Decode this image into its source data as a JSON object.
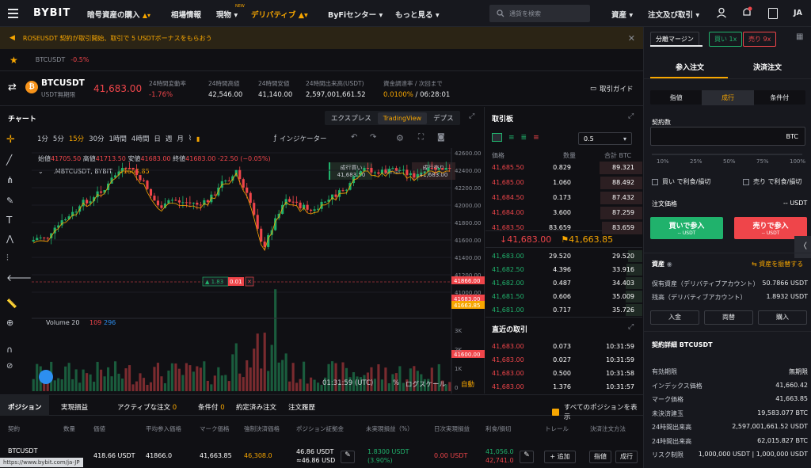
{
  "nav": {
    "logo": "BYBIT",
    "items": [
      "暗号資産の購入",
      "相場情報",
      "現物",
      "デリバティブ",
      "ByFiセンター",
      "もっと見る"
    ],
    "new_badge": "NEW",
    "search_placeholder": "通貨を検索",
    "right": [
      "資産",
      "注文及び取引"
    ],
    "lang": "JA"
  },
  "banner": {
    "text": "ROSEUSDT 契約が取引開始、取引で 5 USDTボーナスをもらおう"
  },
  "ticker_tab": {
    "symbol": "BTCUSDT",
    "change": "-0.5%"
  },
  "header": {
    "symbol": "BTCUSDT",
    "subtitle": "USDT無期限",
    "price": "41,683.00",
    "stats": [
      {
        "label": "24時間変動率",
        "value": "-1.76%",
        "color": "red"
      },
      {
        "label": "24時間高値",
        "value": "42,546.00"
      },
      {
        "label": "24時間安値",
        "value": "41,140.00"
      },
      {
        "label": "24時間出来高(USDT)",
        "value": "2,597,001,661.52"
      },
      {
        "label": "資金調達率 / 次回まで",
        "value": "0.0100% / 06:28:01"
      }
    ],
    "guide": "取引ガイド"
  },
  "chart": {
    "title": "チャート",
    "views": [
      "エクスプレス",
      "TradingView",
      "デプス"
    ],
    "active_view": "TradingView",
    "intervals": [
      "1分",
      "5分",
      "15分",
      "30分",
      "1時間",
      "4時間",
      "日",
      "週",
      "月"
    ],
    "active_interval": "15分",
    "indicator_label": "インジケーター",
    "ohlc": {
      "o_label": "始値",
      "o": "41705.50",
      "h_label": "高値",
      "h": "41713.50",
      "l_label": "安値",
      "l": "41683.00",
      "c_label": "終値",
      "c": "41683.00",
      "chg": "-22.50 (−0.05%)"
    },
    "series_label": ".MBTCUSDT, BYBIT",
    "series_value": "41663.85",
    "buy_box": {
      "label": "成行買い",
      "value": "41,683.50"
    },
    "qty_label": "契約数",
    "sell_box": {
      "label": "成行売り",
      "value": "41,683.00"
    },
    "pos_tag": {
      "qty": "1.83",
      "pnl": "0.01"
    },
    "volume_label": "Volume 20",
    "volume_values": [
      "109",
      "296"
    ],
    "price_ticks": [
      "42600.00",
      "42400.00",
      "42200.00",
      "42000.00",
      "41800.00",
      "41600.00",
      "41400.00",
      "41200.00",
      "41000.00"
    ],
    "price_tags": [
      "41866.00",
      "41683.00",
      "41663.85",
      "41600.00"
    ],
    "vol_ticks": [
      "3K",
      "2K",
      "1K",
      "0"
    ],
    "time_ticks": [
      "06:00",
      "09:00",
      "12:00",
      "15:00",
      "18:00",
      "21:00",
      "20",
      "03:00"
    ],
    "clock": "01:31:59 (UTC)",
    "pct": "%",
    "log": "ログスケール",
    "auto": "自動"
  },
  "orderbook": {
    "title": "取引板",
    "step": "0.5",
    "headers": [
      "価格",
      "数量",
      "合計 BTC"
    ],
    "asks": [
      {
        "price": "41,685.50",
        "qty": "0.829",
        "total": "89.321",
        "depth": 0.98
      },
      {
        "price": "41,685.00",
        "qty": "1.060",
        "total": "88.492",
        "depth": 0.97
      },
      {
        "price": "41,684.50",
        "qty": "0.173",
        "total": "87.432",
        "depth": 0.96
      },
      {
        "price": "41,684.00",
        "qty": "3.600",
        "total": "87.259",
        "depth": 0.96
      },
      {
        "price": "41,683.50",
        "qty": "83.659",
        "total": "83.659",
        "depth": 0.92
      }
    ],
    "last_price": "41,683.00",
    "mark_price": "41,663.85",
    "bids": [
      {
        "price": "41,683.00",
        "qty": "29.520",
        "total": "29.520",
        "depth": 0.32
      },
      {
        "price": "41,682.50",
        "qty": "4.396",
        "total": "33.916",
        "depth": 0.37
      },
      {
        "price": "41,682.00",
        "qty": "0.487",
        "total": "34.403",
        "depth": 0.38
      },
      {
        "price": "41,681.50",
        "qty": "0.606",
        "total": "35.009",
        "depth": 0.38
      },
      {
        "price": "41,681.00",
        "qty": "0.717",
        "total": "35.726",
        "depth": 0.39
      }
    ]
  },
  "trades": {
    "title": "直近の取引",
    "rows": [
      {
        "price": "41,683.00",
        "qty": "0.073",
        "time": "10:31:59"
      },
      {
        "price": "41,683.00",
        "qty": "0.027",
        "time": "10:31:59"
      },
      {
        "price": "41,683.00",
        "qty": "0.500",
        "time": "10:31:58"
      },
      {
        "price": "41,683.00",
        "qty": "1.376",
        "time": "10:31:57"
      }
    ]
  },
  "positions": {
    "tabs": [
      "ポジション",
      "実現損益",
      "アクティブな注文",
      "条件付",
      "約定済み注文",
      "注文履歴"
    ],
    "tab_counts": [
      "",
      "",
      "0",
      "0",
      "",
      ""
    ],
    "show_all": "すべてのポジションを表示",
    "headers": [
      "契約",
      "数量",
      "価値",
      "平均参入価格",
      "マーク価格",
      "強制決済価格",
      "ポジション証拠金",
      "未実現損益（%）",
      "日次実現損益",
      "利食/損切",
      "トレール",
      "決済注文方法"
    ],
    "row": {
      "contract": "BTCUSDT",
      "value": "418.66 USDT",
      "entry": "41866.0",
      "mark": "41,663.85",
      "liq": "46,308.0",
      "margin1": "46.86 USDT",
      "margin2": "≈46.86 USD",
      "upnl1": "1.8300 USDT",
      "upnl2": "(3.90%)",
      "daily": "0.00 USDT",
      "tp": "41,056.0",
      "sl": "42,741.0",
      "add": "追加",
      "btn1": "指値",
      "btn2": "成行"
    },
    "status_url": "https://www.bybit.com/ja-JP"
  },
  "panel": {
    "margin_mode": "分離マージン",
    "buy_lev": "買い 1x",
    "sell_lev": "売り 9x",
    "tabs": [
      "参入注文",
      "決済注文"
    ],
    "order_types": [
      "指値",
      "成行",
      "条件付"
    ],
    "active_type": "成行",
    "qty_label": "契約数",
    "qty_unit": "BTC",
    "pcts": [
      "10%",
      "25%",
      "50%",
      "75%",
      "100%"
    ],
    "tp_buy": "買い で利食/損切",
    "tp_sell": "売り で利食/損切",
    "cost_label": "注文価格",
    "cost_value": "-- USDT",
    "buy_btn": "買いで参入",
    "buy_sub": "-- USDT",
    "sell_btn": "売りで参入",
    "sell_sub": "-- USDT",
    "assets_title": "資産",
    "transfer": "資産を振替する",
    "assets": [
      {
        "k": "保有資産（デリバティブアカウント）",
        "v": "50.7866 USDT"
      },
      {
        "k": "残高（デリバティブアカウント）",
        "v": "1.8932 USDT"
      }
    ],
    "asset_btns": [
      "入金",
      "両替",
      "購入"
    ],
    "contract_title": "契約詳細 BTCUSDT",
    "details": [
      {
        "k": "有効期限",
        "v": "無期限"
      },
      {
        "k": "インデックス価格",
        "v": "41,660.42"
      },
      {
        "k": "マーク価格",
        "v": "41,663.85"
      },
      {
        "k": "未決済建玉",
        "v": "19,583.077 BTC"
      },
      {
        "k": "24時間出来高",
        "v": "2,597,001,661.52 USDT"
      },
      {
        "k": "24時間出来高",
        "v": "62,015.827 BTC"
      },
      {
        "k": "リスク制限",
        "v": "1,000,000 USDT | 1,000,000 USDT"
      }
    ]
  }
}
